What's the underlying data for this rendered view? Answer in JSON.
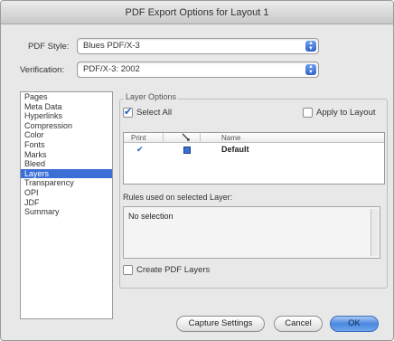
{
  "window": {
    "title": "PDF Export Options for Layout 1"
  },
  "pdf_style": {
    "label": "PDF Style:",
    "value": "Blues PDF/X-3"
  },
  "verification": {
    "label": "Verification:",
    "value": "PDF/X-3: 2002"
  },
  "sidebar": {
    "items": [
      {
        "label": "Pages",
        "selected": false
      },
      {
        "label": "Meta Data",
        "selected": false
      },
      {
        "label": "Hyperlinks",
        "selected": false
      },
      {
        "label": "Compression",
        "selected": false
      },
      {
        "label": "Color",
        "selected": false
      },
      {
        "label": "Fonts",
        "selected": false
      },
      {
        "label": "Marks",
        "selected": false
      },
      {
        "label": "Bleed",
        "selected": false
      },
      {
        "label": "Layers",
        "selected": true
      },
      {
        "label": "Transparency",
        "selected": false
      },
      {
        "label": "OPI",
        "selected": false
      },
      {
        "label": "JDF",
        "selected": false
      },
      {
        "label": "Summary",
        "selected": false
      }
    ],
    "selected_color": "#3b6fd6"
  },
  "layer_options": {
    "title": "Layer Options",
    "select_all_label": "Select All",
    "select_all_checked": true,
    "apply_to_layout_label": "Apply to Layout",
    "apply_to_layout_checked": false,
    "columns": {
      "print": "Print",
      "icon": "pen-icon",
      "name": "Name"
    },
    "rows": [
      {
        "print": true,
        "icon": "color-swatch-icon",
        "name": "Default"
      }
    ]
  },
  "rules": {
    "label": "Rules used on selected Layer:",
    "content": "No selection"
  },
  "create_pdf_layers": {
    "label": "Create PDF Layers",
    "checked": false
  },
  "buttons": {
    "capture": "Capture Settings",
    "cancel": "Cancel",
    "ok": "OK"
  },
  "colors": {
    "accent": "#3b6fd6",
    "window_bg": "#e8e8e8"
  }
}
